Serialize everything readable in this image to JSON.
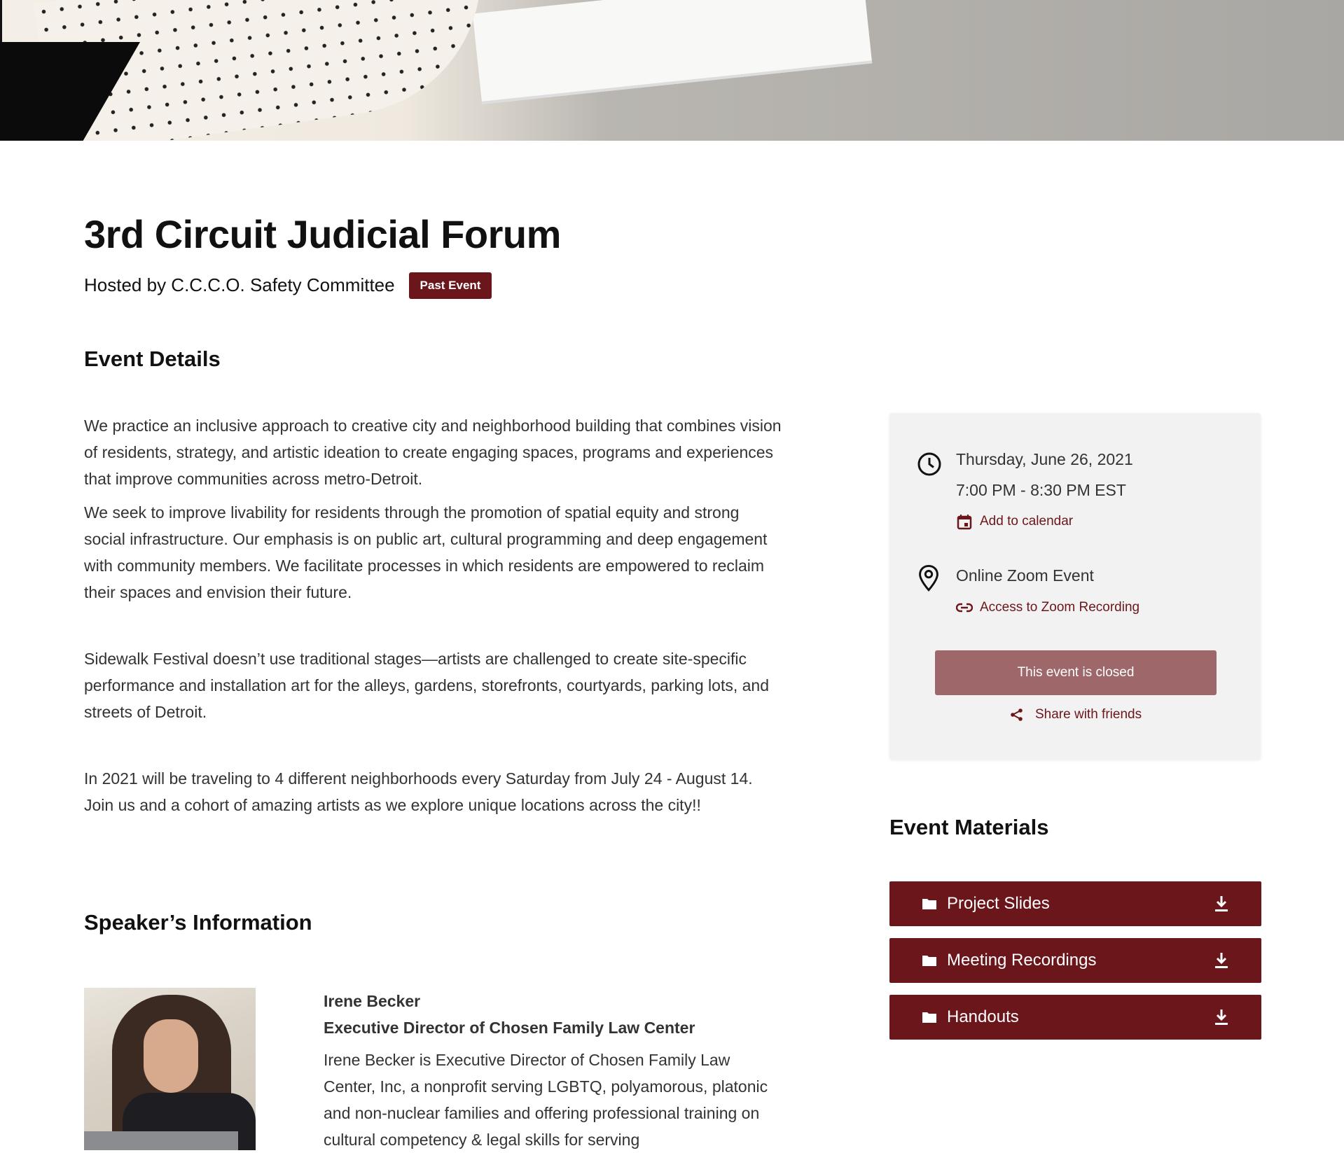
{
  "event": {
    "title": "3rd Circuit Judicial Forum",
    "host": "Hosted by C.C.C.O. Safety Committee",
    "badge": "Past Event"
  },
  "details": {
    "heading": "Event Details",
    "paragraphs": [
      "We practice an inclusive approach to creative city and neighborhood building that combines vision of residents, strategy, and artistic ideation to create engaging spaces, programs and experiences that improve communities across metro-Detroit.",
      "We seek to improve livability for residents through the promotion of spatial equity and strong social infrastructure. Our emphasis is on public art, cultural programming and deep engagement with community members. We facilitate processes in which residents are empowered to reclaim their spaces and envision their future.",
      "Sidewalk Festival doesn’t use traditional stages—artists are challenged to create site-specific performance and installation art for the alleys, gardens, storefronts, courtyards, parking lots, and streets of Detroit.",
      "In 2021 will be traveling to 4 different neighborhoods every Saturday from July 24 - August 14. Join us and a cohort of amazing artists as we explore unique locations across the city!!"
    ]
  },
  "card": {
    "date": "Thursday, June 26, 2021",
    "time": "7:00 PM - 8:30 PM EST",
    "add_calendar": "Add to calendar",
    "location": "Online Zoom Event",
    "recording_link": "Access to Zoom Recording",
    "closed_button": "This event is closed",
    "share": "Share with friends"
  },
  "materials": {
    "heading": "Event Materials",
    "items": [
      {
        "label": "Project Slides"
      },
      {
        "label": "Meeting Recordings"
      },
      {
        "label": "Handouts"
      }
    ]
  },
  "speakers": {
    "heading": "Speaker’s Information",
    "name": "Irene Becker",
    "role": "Executive Director of Chosen Family Law Center",
    "bio": "Irene Becker is Executive Director of Chosen Family Law Center, Inc, a nonprofit serving LGBTQ, polyamorous, platonic and non-nuclear families and offering professional training on cultural competency & legal skills for serving"
  },
  "colors": {
    "accent": "#6b161b",
    "closed": "#9e686b",
    "card_bg": "#f2f2f2"
  }
}
